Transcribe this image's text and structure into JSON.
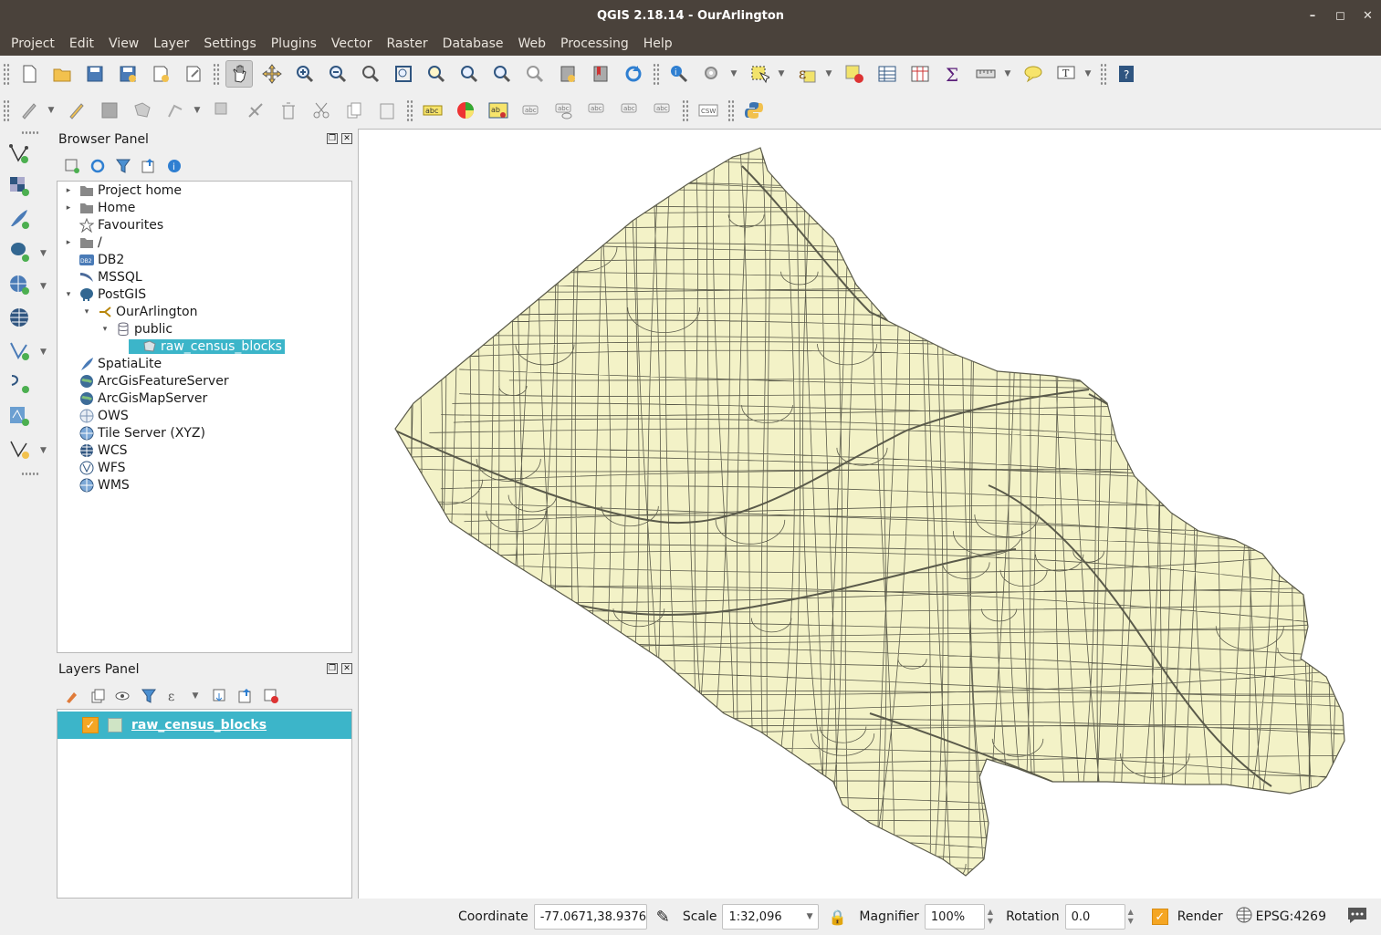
{
  "window": {
    "title": "QGIS 2.18.14 - OurArlington"
  },
  "menu": [
    "Project",
    "Edit",
    "View",
    "Layer",
    "Settings",
    "Plugins",
    "Vector",
    "Raster",
    "Database",
    "Web",
    "Processing",
    "Help"
  ],
  "toolbar1": [
    "new-project-icon",
    "open-project-icon",
    "save-project-icon",
    "save-as-icon",
    "new-print-composer-icon",
    "composer-manager-icon",
    "pan-icon",
    "pan-to-selection-icon",
    "zoom-in-icon",
    "zoom-out-icon",
    "zoom-native-icon",
    "zoom-full-icon",
    "zoom-to-selection-icon",
    "zoom-to-layer-icon",
    "zoom-last-icon",
    "zoom-next-icon",
    "new-bookmark-icon",
    "show-bookmarks-icon",
    "refresh-icon",
    "identify-icon",
    "run-action-icon",
    "select-features-icon",
    "select-by-expression-icon",
    "deselect-icon",
    "attribute-table-icon",
    "statistics-icon",
    "field-calculator-icon",
    "measure-icon",
    "map-tips-icon",
    "text-annotation-icon",
    "help-icon"
  ],
  "toolbar2": [
    "current-edits-icon",
    "toggle-editing-icon",
    "save-edits-icon",
    "add-feature-icon",
    "move-feature-icon",
    "node-tool-icon",
    "delete-selected-icon",
    "cut-features-icon",
    "copy-features-icon",
    "paste-features-icon",
    "layer-labeling-icon",
    "style-manager-icon",
    "layer-diagram-icon",
    "pin-labels-icon",
    "show-hide-labels-icon",
    "move-label-icon",
    "rotate-label-icon",
    "change-label-icon",
    "csw-icon",
    "python-console-icon"
  ],
  "toolbar2_labels": {
    "csw": "CSW",
    "abc": "abc",
    "ab": "ab"
  },
  "browser": {
    "title": "Browser Panel",
    "items": [
      {
        "label": "Project home",
        "icon": "folder-icon",
        "expand": "▸"
      },
      {
        "label": "Home",
        "icon": "folder-icon",
        "expand": "▸"
      },
      {
        "label": "Favourites",
        "icon": "star-icon",
        "expand": ""
      },
      {
        "label": "/",
        "icon": "folder-icon",
        "expand": "▸"
      },
      {
        "label": "DB2",
        "icon": "db2-icon",
        "expand": "",
        "badge": "DB2"
      },
      {
        "label": "MSSQL",
        "icon": "mssql-icon",
        "expand": ""
      },
      {
        "label": "PostGIS",
        "icon": "postgis-elephant-icon",
        "expand": "▾"
      },
      {
        "label": "OurArlington",
        "icon": "connection-icon",
        "expand": "▾"
      },
      {
        "label": "public",
        "icon": "schema-icon",
        "expand": "▾"
      },
      {
        "label": "raw_census_blocks",
        "icon": "polygon-layer-icon",
        "expand": "",
        "selected": true
      },
      {
        "label": "SpatiaLite",
        "icon": "spatialite-feather-icon",
        "expand": ""
      },
      {
        "label": "ArcGisFeatureServer",
        "icon": "arcgis-icon",
        "expand": ""
      },
      {
        "label": "ArcGisMapServer",
        "icon": "arcgis-icon",
        "expand": ""
      },
      {
        "label": "OWS",
        "icon": "globe-icon",
        "expand": ""
      },
      {
        "label": "Tile Server (XYZ)",
        "icon": "globe-icon",
        "expand": ""
      },
      {
        "label": "WCS",
        "icon": "globe-icon",
        "expand": ""
      },
      {
        "label": "WFS",
        "icon": "globe-icon",
        "expand": ""
      },
      {
        "label": "WMS",
        "icon": "globe-icon",
        "expand": ""
      }
    ]
  },
  "layers": {
    "title": "Layers Panel",
    "items": [
      {
        "label": "raw_census_blocks",
        "checked": true
      }
    ]
  },
  "status": {
    "coordinate_label": "Coordinate",
    "coordinate": "-77.0671,38.9376",
    "scale_label": "Scale",
    "scale": "1:32,096",
    "magnifier_label": "Magnifier",
    "magnifier": "100%",
    "rotation_label": "Rotation",
    "rotation": "0.0",
    "render_label": "Render",
    "crs": "EPSG:4269"
  },
  "colors": {
    "accent": "#3cb5c9",
    "titlebar": "#4a423b",
    "map_fill": "#f3f2c7",
    "map_stroke": "#5a5a4a",
    "checkbox": "#f5a623"
  }
}
